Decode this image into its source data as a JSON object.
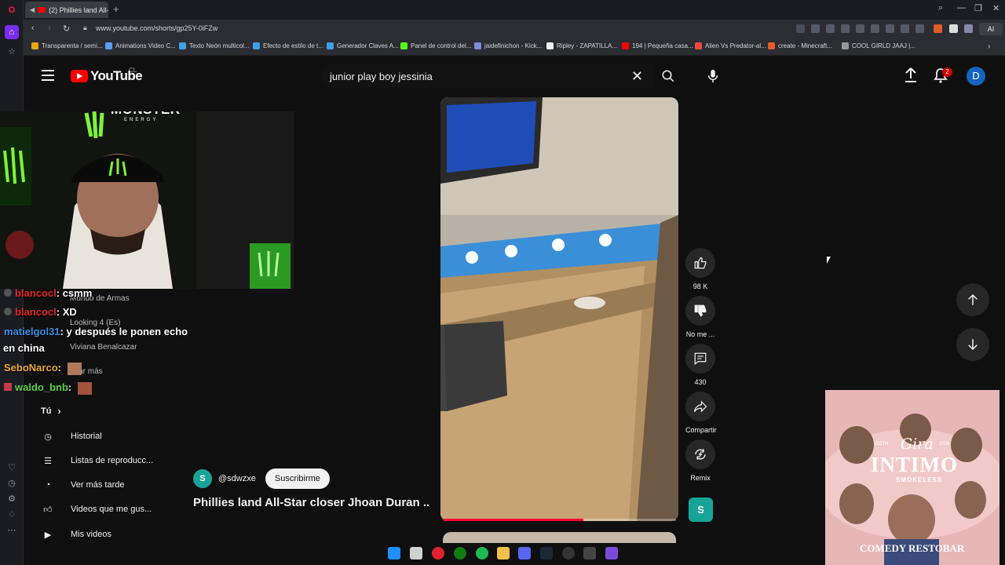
{
  "browser": {
    "tab_title": "(2) Phillies land All-St",
    "url": "www.youtube.com/shorts/gp25Y-0iFZw",
    "bookmarks": [
      "Transparenta / semi...",
      "Animations Video C...",
      "Texto Neón multicol...",
      "Efecto de estilo de t...",
      "Generador Claves A...",
      "Panel de control del...",
      "jaidefinichon - Kick...",
      "Ripley - ZAPATILLA...",
      "194 | Pequeña casa...",
      "Alien Vs Predator-al...",
      "create - Minecraft...",
      "COOL GIRLD JAAJ |..."
    ],
    "ai_label": "AI"
  },
  "header": {
    "logo_text": "YouTube",
    "country": "CL",
    "search_value": "junior play boy jessinia",
    "notification_count": "2",
    "avatar_letter": "D"
  },
  "sidebar": {
    "subscriptions": [
      "Mundo de Armas",
      "Looking 4 (Es)",
      "Viviana Benalcazar"
    ],
    "show_more": "strar más",
    "you_label": "Tú",
    "items": [
      "Historial",
      "Listas de reproducc...",
      "Ver más tarde",
      "Videos que me gus...",
      "Mis videos"
    ]
  },
  "stream_overlay": {
    "brand": "MONSTER",
    "brand_sub": "ENERGY",
    "chat": [
      {
        "user": "blancocl",
        "msg": ": csmm",
        "color": "#e5262a"
      },
      {
        "user": "blancocl",
        "msg": ": XD",
        "color": "#e5262a"
      },
      {
        "user": "matielgol31",
        "msg": ": y después le ponen echo",
        "color": "#3b8de6"
      },
      {
        "user": "",
        "msg": "en china",
        "color": "#ffffff"
      },
      {
        "user": "SeboNarco",
        "msg": ":",
        "color": "#e8a93a"
      },
      {
        "user": "waldo_bnb",
        "msg": ":",
        "color": "#5fd14a"
      }
    ]
  },
  "short": {
    "channel_letter": "S",
    "channel": "@sdwzxe",
    "subscribe": "Suscribirme",
    "title": "Phillies land All-Star closer Jhoan Duran ...",
    "progress": 0.6,
    "actions": {
      "likes": "98 K",
      "dislike": "No me ...",
      "comments": "430",
      "share": "Compartir",
      "remix": "Remix"
    },
    "remix_letter": "S"
  },
  "poster": {
    "title": "INTIMO",
    "script": "Gira",
    "artist": "SMOKELESS",
    "footer": "COMEDY RESTOBAR",
    "year_left": "GOTH",
    "year_right": "2026"
  }
}
